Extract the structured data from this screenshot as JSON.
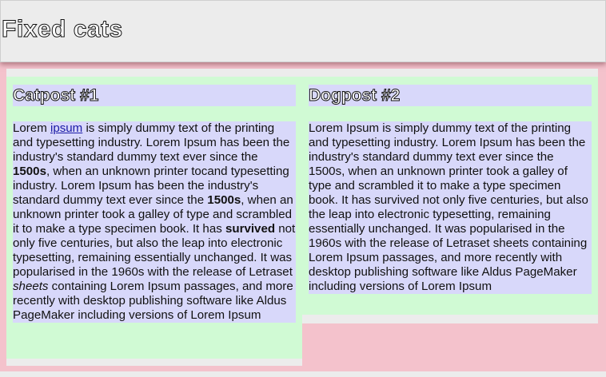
{
  "header": {
    "title": "Fixed cats"
  },
  "posts": [
    {
      "title": "Catpost #1",
      "body": {
        "t1": "Lorem ",
        "link": "ipsum",
        "t2": " is simply dummy text of the printing and typesetting industry. Lorem Ipsum has been the industry's standard dummy text ever since the ",
        "b1": "1500s",
        "t3": ", when an unknown printer tocand typesetting industry. Lorem Ipsum has been the industry's standard dummy text ever since the ",
        "b2": "1500s",
        "t4": ", when an unknown printer took a galley of type and scrambled it to make a type specimen book. It has ",
        "b3": "survived",
        "t5": " not only five centuries, but also the leap into electronic typesetting, remaining essentially unchanged. It was popularised in the 1960s with the release of Letraset ",
        "i1": "sheets",
        "t6": " containing Lorem Ipsum passages, and more recently with desktop publishing software like Aldus PageMaker including versions of Lorem Ipsum"
      }
    },
    {
      "title": "Dogpost #2",
      "body": "Lorem Ipsum is simply dummy text of the printing and typesetting industry. Lorem Ipsum has been the industry's standard dummy text ever since the 1500s, when an unknown printer took a galley of type and scrambled it to make a type specimen book. It has survived not only five centuries, but also the leap into electronic typesetting, remaining essentially unchanged. It was popularised in the 1960s with the release of Letraset sheets containing Lorem Ipsum passages, and more recently with desktop publishing software like Aldus PageMaker including versions of Lorem Ipsum"
    }
  ]
}
